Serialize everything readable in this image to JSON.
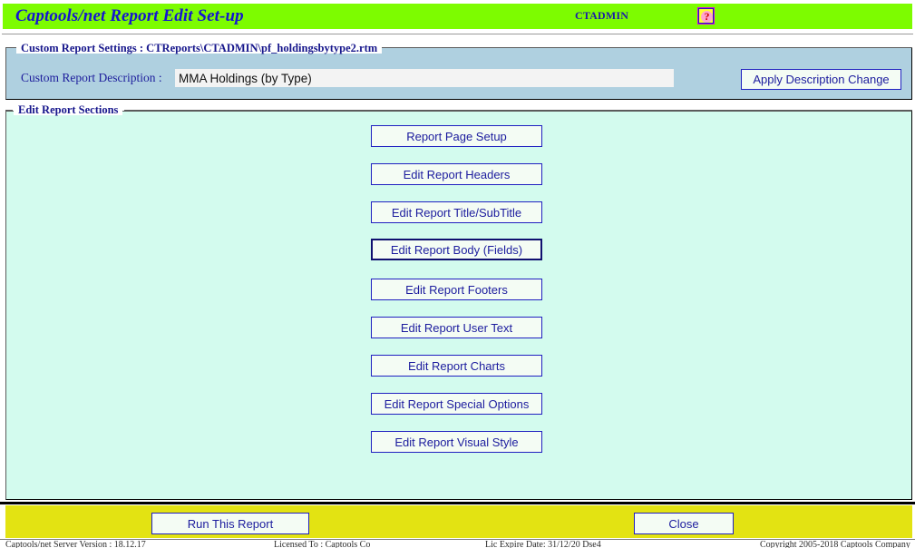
{
  "titlebar": {
    "app_title": "Captools/net Report Edit Set-up",
    "user": "CTADMIN",
    "help_glyph": "?",
    "bg_color": "#7dfc00",
    "title_color": "#1515d0"
  },
  "settings_group": {
    "legend": "Custom Report Settings : CTReports\\CTADMIN\\pf_holdingsbytype2.rtm",
    "description_label": "Custom Report Description :",
    "description_value": "MMA Holdings (by Type)",
    "description_placeholder": "",
    "apply_label": "Apply Description Change",
    "bg_color": "#afd0e0"
  },
  "sections_group": {
    "legend": "Edit Report Sections",
    "bg_color": "#d3fbee",
    "buttons": [
      {
        "label": "Report Page Setup",
        "name": "report-page-setup-button",
        "focused": false
      },
      {
        "label": "Edit Report Headers",
        "name": "edit-report-headers-button",
        "focused": false
      },
      {
        "label": "Edit Report Title/SubTitle",
        "name": "edit-report-title-subtitle-button",
        "focused": false
      },
      {
        "label": "Edit Report Body (Fields)",
        "name": "edit-report-body-fields-button",
        "focused": true
      },
      {
        "label": "Edit Report Footers",
        "name": "edit-report-footers-button",
        "focused": false
      },
      {
        "label": "Edit Report User Text",
        "name": "edit-report-user-text-button",
        "focused": false
      },
      {
        "label": "Edit Report Charts",
        "name": "edit-report-charts-button",
        "focused": false
      },
      {
        "label": "Edit Report Special Options",
        "name": "edit-report-special-options-button",
        "focused": false
      },
      {
        "label": "Edit Report Visual Style",
        "name": "edit-report-visual-style-button",
        "focused": false
      }
    ]
  },
  "bottombar": {
    "run_label": "Run This Report",
    "close_label": "Close",
    "bg_color": "#e3e312"
  },
  "statusbar": {
    "version": "Captools/net Server Version : 18.12.17",
    "licensed_to": "Licensed To : Captools Co",
    "license_expire": "Lic Expire Date: 31/12/20 Dse4",
    "copyright": "Copyright 2005-2018  Captools Company"
  }
}
